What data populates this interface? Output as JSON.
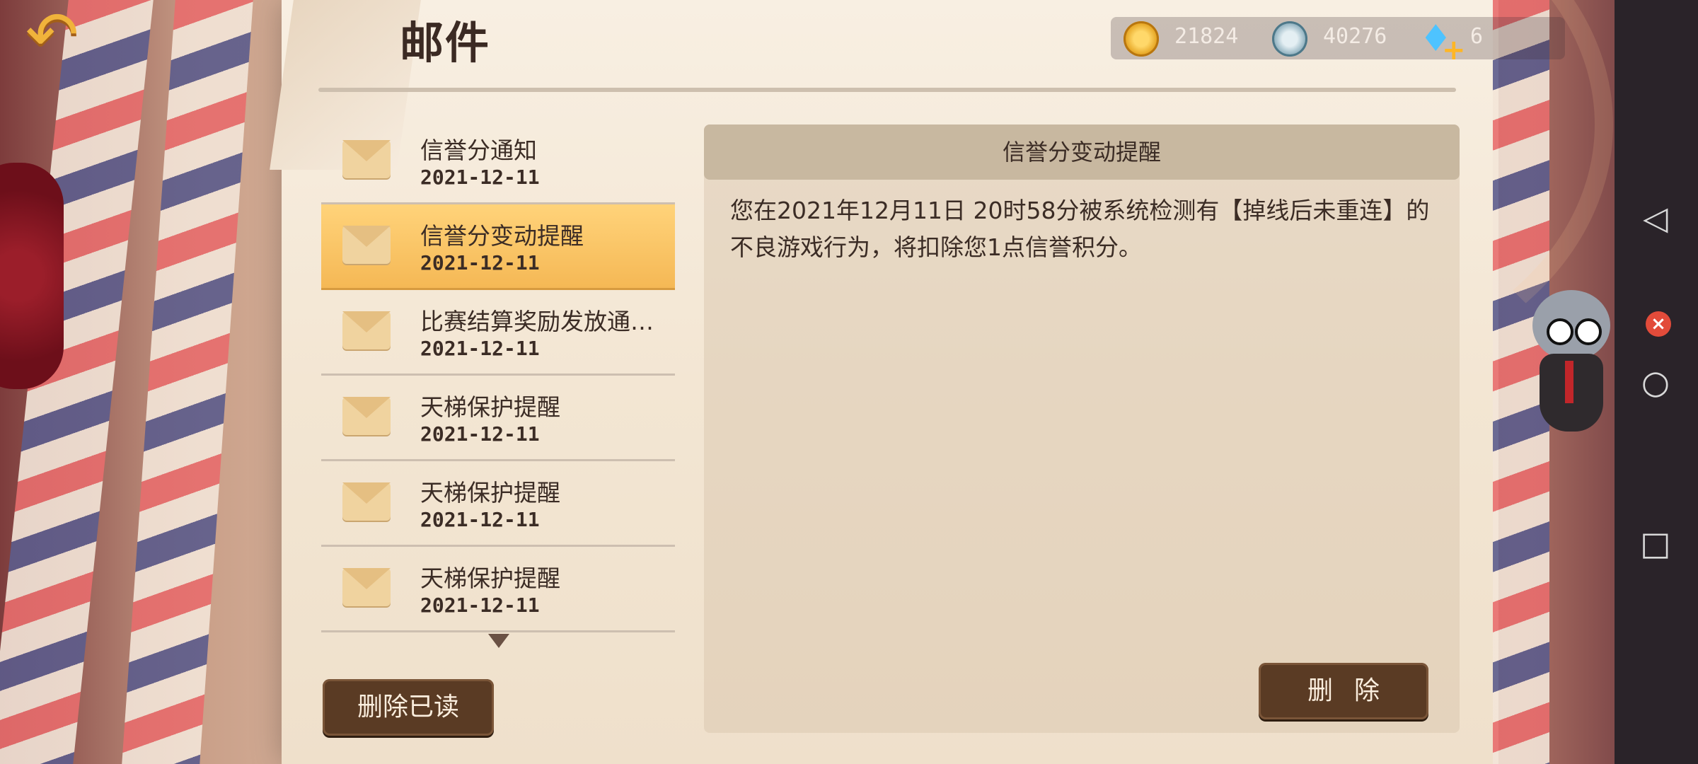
{
  "header": {
    "title": "邮件",
    "back_icon": "back-arrow-icon"
  },
  "currencies": {
    "gold": "21824",
    "silver": "40276",
    "diamond": "6"
  },
  "mail_list": [
    {
      "title": "信誉分通知",
      "date": "2021-12-11",
      "selected": false
    },
    {
      "title": "信誉分变动提醒",
      "date": "2021-12-11",
      "selected": true
    },
    {
      "title": "比赛结算奖励发放通…",
      "date": "2021-12-11",
      "selected": false
    },
    {
      "title": "天梯保护提醒",
      "date": "2021-12-11",
      "selected": false
    },
    {
      "title": "天梯保护提醒",
      "date": "2021-12-11",
      "selected": false
    },
    {
      "title": "天梯保护提醒",
      "date": "2021-12-11",
      "selected": false
    }
  ],
  "buttons": {
    "delete_read": "删除已读",
    "delete": "删除"
  },
  "detail": {
    "title": "信誉分变动提醒",
    "body_line1": "您在2021年12月11日 20时58分被系统检测有【掉线后未重连】的",
    "body_line2": "不良游戏行为，将扣除您1点信誉积分。"
  },
  "system_nav": {
    "back": "◁",
    "home": "○",
    "recent": "□"
  }
}
